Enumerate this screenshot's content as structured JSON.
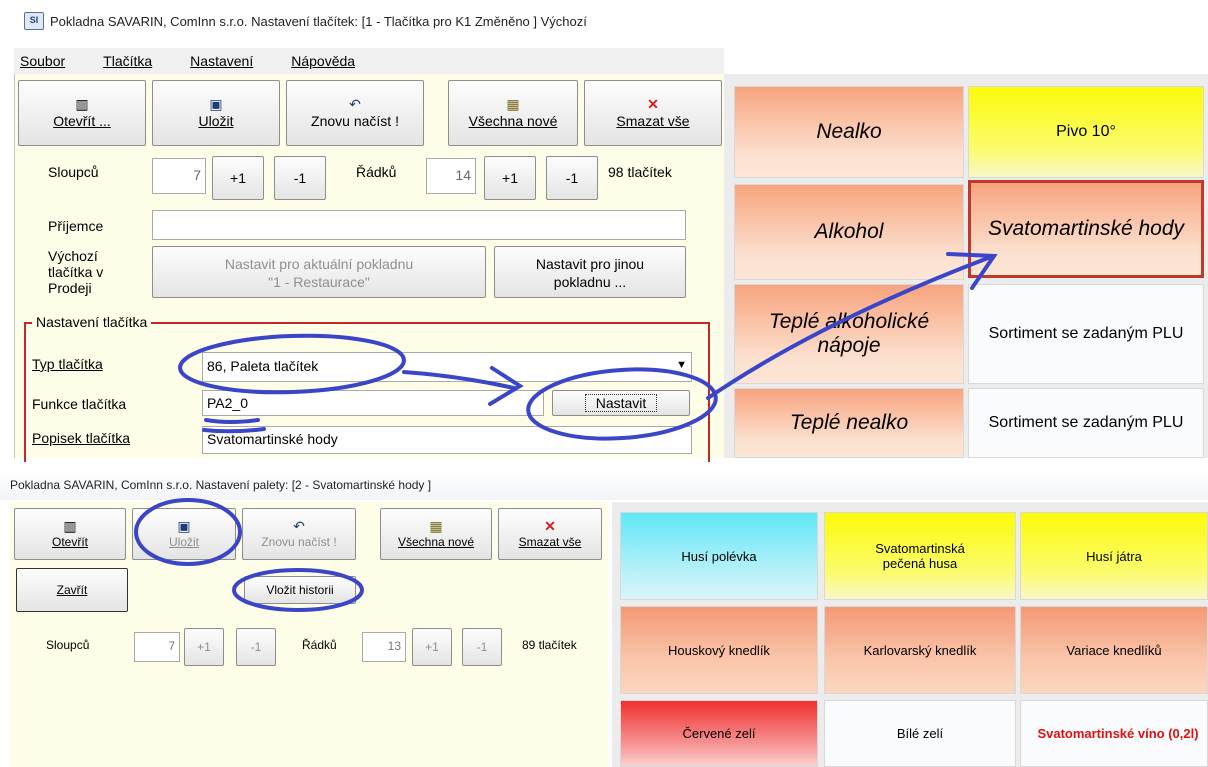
{
  "top": {
    "title": "Pokladna SAVARIN, ComInn s.r.o.  Nastavení tlačítek: [1 - Tlačítka pro K1  Změněno  ] Výchozí",
    "app_icon": "SI",
    "menu": [
      "Soubor",
      "Tlačítka",
      "Nastavení",
      "Nápověda"
    ],
    "toolbar": {
      "open": "Otevřít ...",
      "save": "Uložit",
      "reload": "Znovu načíst !",
      "new_all": "Všechna nové",
      "delete_all": "Smazat vše"
    },
    "cols_label": "Sloupců",
    "cols_value": "7",
    "plus": "+1",
    "minus": "-1",
    "rows_label": "Řádků",
    "rows_value": "14",
    "count": "98 tlačítek",
    "recipient_label": "Příjemce",
    "default_label": [
      "Výchozí",
      "tlačítka v",
      "Prodeji"
    ],
    "set_current_line1": "Nastavit pro aktuální pokladnu",
    "set_current_line2": "\"1 - Restaurace\"",
    "set_other_line1": "Nastavit pro jinou",
    "set_other_line2": "pokladnu ...",
    "group_title": "Nastavení tlačítka",
    "type_label": "Typ tlačítka",
    "type_value": "86, Paleta tlačítek",
    "func_label": "Funkce tlačítka",
    "func_value": "PA2_0",
    "set_button": "Nastavit",
    "desc_label": "Popisek tlačítka",
    "desc_value": "Svatomartinské hody",
    "grid": {
      "c1": [
        "Nealko",
        "Alkohol",
        "Teplé alkoholické nápoje",
        "Teplé nealko"
      ],
      "c2": [
        "Pivo 10°",
        "Svatomartinské hody",
        "Sortiment se zadaným PLU",
        "Sortiment se zadaným PLU"
      ]
    }
  },
  "bottom": {
    "title": "Pokladna SAVARIN, ComInn s.r.o. Nastavení palety: [2 - Svatomartinské hody ]",
    "toolbar": {
      "open": "Otevřít",
      "save": "Uložit",
      "reload": "Znovu načíst !",
      "new_all": "Všechna nové",
      "delete_all": "Smazat vše"
    },
    "close": "Zavřít",
    "insert_history": "Vložit historii",
    "cols_label": "Sloupců",
    "cols_value": "7",
    "plus": "+1",
    "minus": "-1",
    "rows_label": "Řádků",
    "rows_value": "13",
    "count": "89 tlačítek",
    "grid": [
      [
        "Husí polévka",
        "Svatomartinská pečená husa",
        "Husí játra"
      ],
      [
        "Houskový knedlík",
        "Karlovarský knedlík",
        "Variace knedlíků"
      ],
      [
        "Červené zelí",
        "Bílé zelí",
        "Svatomartinské víno (0,2l)"
      ]
    ]
  },
  "colors": {
    "annotation": "#3a45c8",
    "highlight_border": "#c0392b",
    "red_text": "#e01010"
  }
}
